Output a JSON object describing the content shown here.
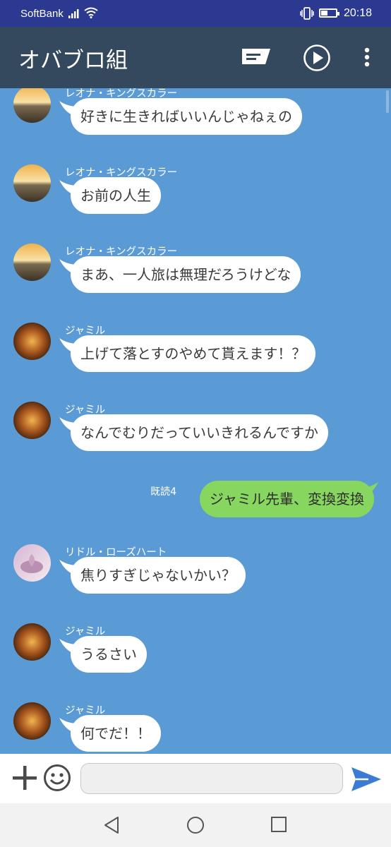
{
  "status_bar": {
    "carrier": "SoftBank",
    "time": "20:18"
  },
  "header": {
    "title": "オバブロ組"
  },
  "colors": {
    "chat_bg": "#5b9bd5",
    "header_bg": "#34495e",
    "status_bg": "#2b3990",
    "my_bubble": "#86d65f",
    "send_accent": "#3a7bd5"
  },
  "messages": [
    {
      "sender": "レオナ・キングスカラー",
      "text": "好きに生きればいいんじゃねぇの",
      "avatar": "leona-avatar"
    },
    {
      "sender": "レオナ・キングスカラー",
      "text": "お前の人生",
      "avatar": "leona-avatar"
    },
    {
      "sender": "レオナ・キングスカラー",
      "text": "まあ、一人旅は無理だろうけどな",
      "avatar": "leona-avatar"
    },
    {
      "sender": "ジャミル",
      "text": "上げて落とすのやめて貰えます！？",
      "avatar": "jamil-avatar"
    },
    {
      "sender": "ジャミル",
      "text": "なんでむりだっていいきれるんですか",
      "avatar": "jamil-avatar"
    },
    {
      "mine": true,
      "text": "ジャミル先輩、変換変換",
      "read": "既読4"
    },
    {
      "sender": "リドル・ローズハート",
      "text": "焦りすぎじゃないかい？",
      "avatar": "riddle-avatar"
    },
    {
      "sender": "ジャミル",
      "text": "うるさい",
      "avatar": "jamil-avatar"
    },
    {
      "sender": "ジャミル",
      "text": "何でだ！！",
      "avatar": "jamil-avatar"
    }
  ],
  "input": {
    "value": "",
    "placeholder": ""
  }
}
